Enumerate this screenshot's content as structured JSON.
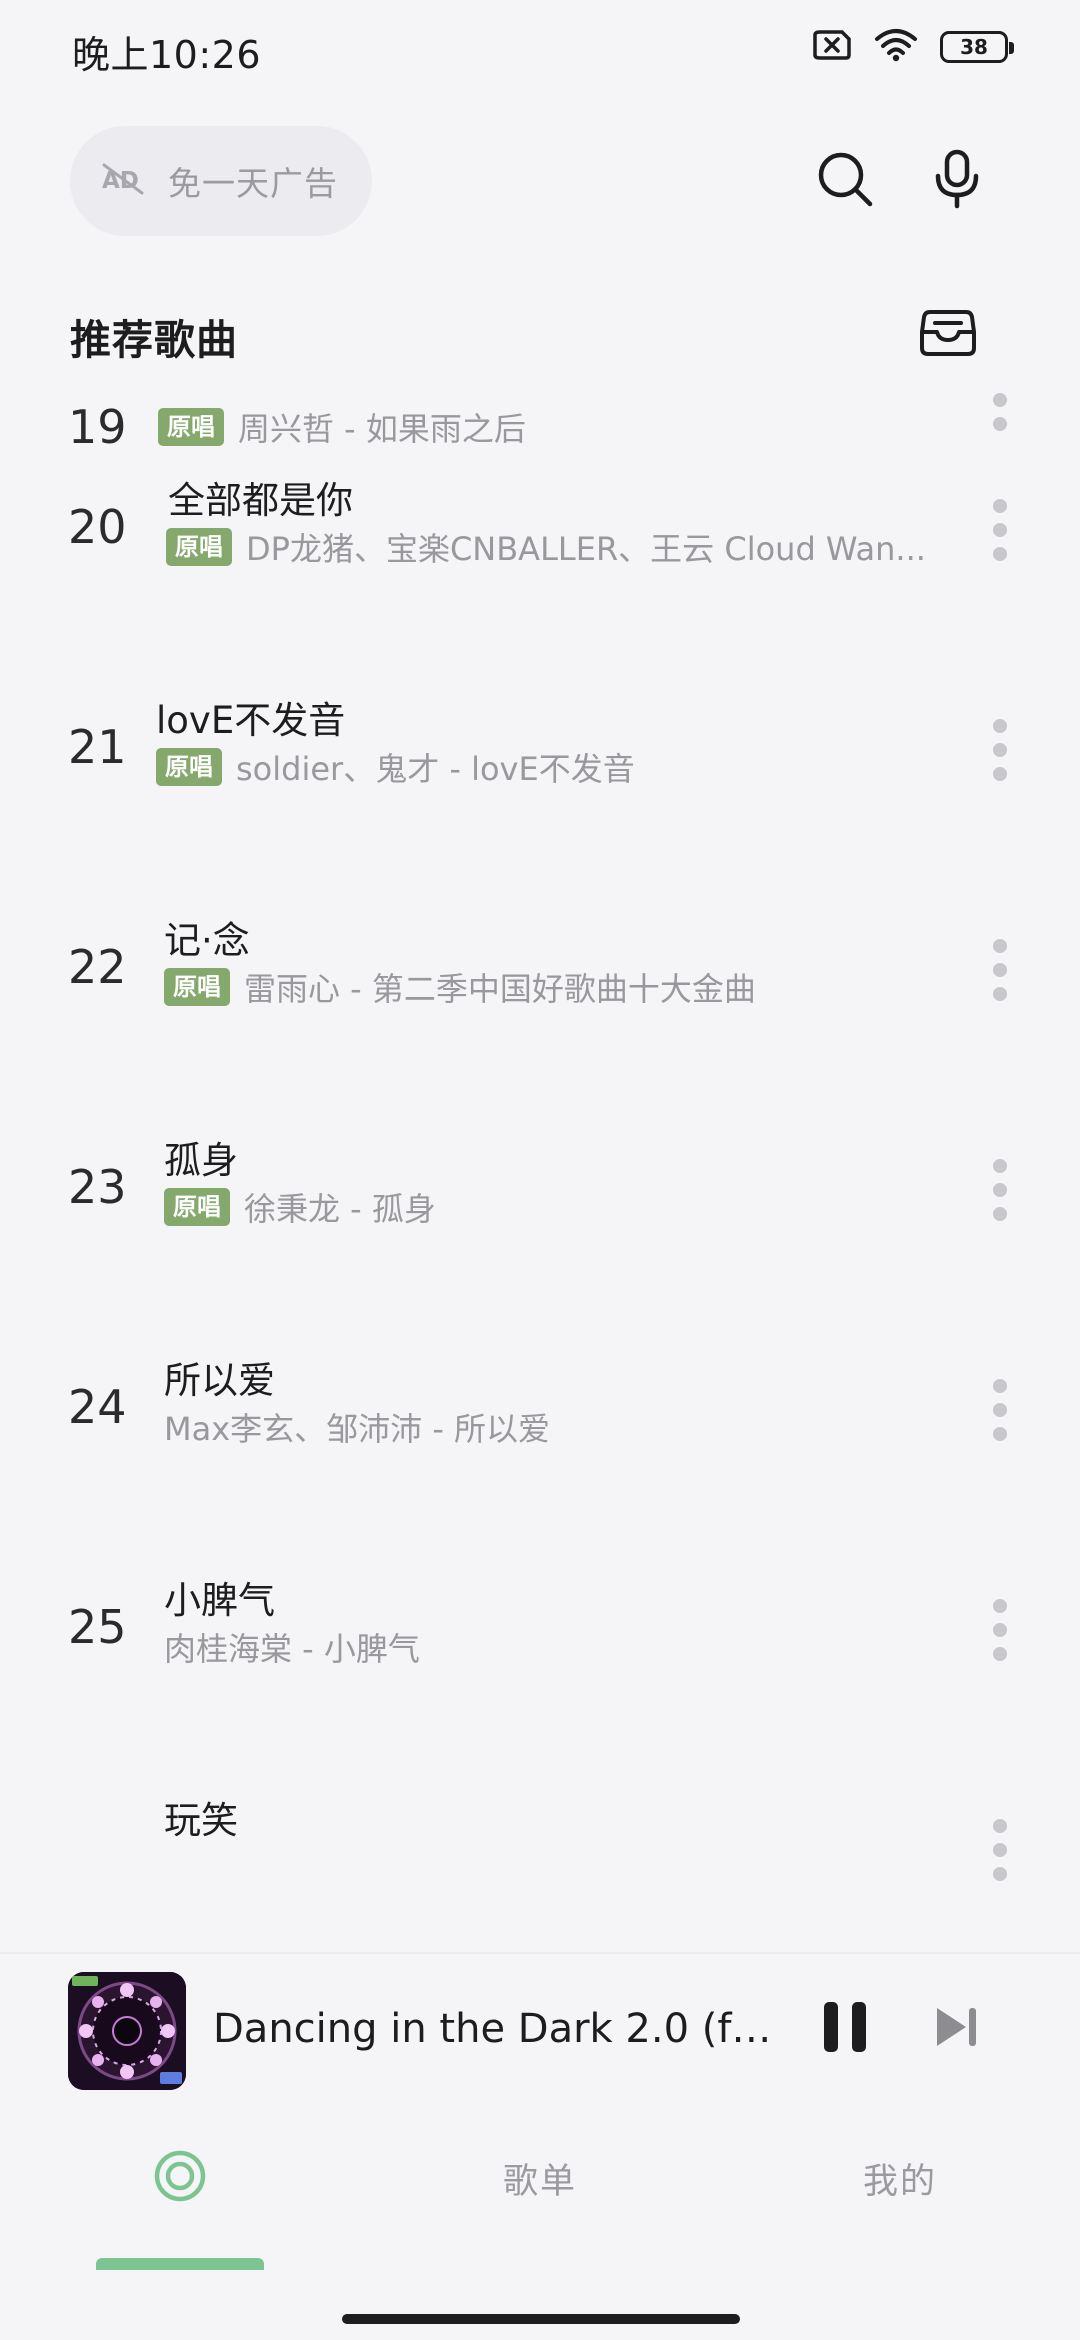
{
  "status_bar": {
    "time": "晚上10:26",
    "battery": "38",
    "icons": [
      "sim-error-icon",
      "wifi-icon",
      "battery-icon"
    ]
  },
  "header": {
    "ad_pill_label": "免一天广告",
    "ad_pill_icon": "ad-free-icon",
    "search_icon": "search-icon",
    "voice_icon": "microphone-icon"
  },
  "section": {
    "title": "推荐歌曲",
    "action_icon": "inbox-icon"
  },
  "songs": [
    {
      "rank": "19",
      "title": "",
      "badge": "原唱",
      "artist": "周兴哲 - 如果雨之后"
    },
    {
      "rank": "20",
      "title": "全部都是你",
      "badge": "原唱",
      "artist": "DP龙猪、宝楽CNBALLER、王云 Cloud Wan..."
    },
    {
      "rank": "21",
      "title": "lovE不发音",
      "badge": "原唱",
      "artist": "soldier、鬼才 - lovE不发音"
    },
    {
      "rank": "22",
      "title": "记·念",
      "badge": "原唱",
      "artist": "雷雨心 - 第二季中国好歌曲十大金曲"
    },
    {
      "rank": "23",
      "title": "孤身",
      "badge": "原唱",
      "artist": "徐秉龙 - 孤身"
    },
    {
      "rank": "24",
      "title": "所以爱",
      "badge": "",
      "artist": "Max李玄、邹沛沛 - 所以爱"
    },
    {
      "rank": "25",
      "title": "小脾气",
      "badge": "",
      "artist": "肉桂海棠 - 小脾气"
    },
    {
      "rank": "",
      "title": "玩笑",
      "badge": "",
      "artist": ""
    }
  ],
  "player": {
    "title": "Dancing in the Dark 2.0 (fe...",
    "state": "playing",
    "pause_icon": "pause-icon",
    "next_icon": "skip-next-icon"
  },
  "bottom_nav": {
    "items": [
      {
        "label": "",
        "icon": "home-radar-icon",
        "active": true
      },
      {
        "label": "歌单",
        "active": false
      },
      {
        "label": "我的",
        "active": false
      }
    ]
  },
  "colors": {
    "background": "#f5f5f8",
    "badge": "#85a86d",
    "accent": "#7cc592",
    "text_primary": "#1d1d1f",
    "text_secondary": "#98989d"
  }
}
